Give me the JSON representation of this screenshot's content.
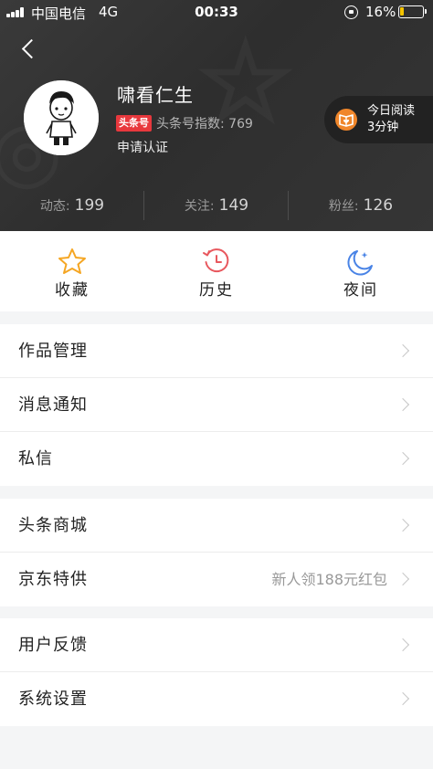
{
  "status_bar": {
    "carrier": "中国电信",
    "network": "4G",
    "time": "00:33",
    "battery": "16%"
  },
  "profile": {
    "username": "啸看仁生",
    "badge": "头条号",
    "index_label": "头条号指数:",
    "index_value": "769",
    "apply_cert": "申请认证"
  },
  "reading": {
    "line1": "今日阅读",
    "line2": "3分钟"
  },
  "stats": [
    {
      "label": "动态:",
      "value": "199"
    },
    {
      "label": "关注:",
      "value": "149"
    },
    {
      "label": "粉丝:",
      "value": "126"
    }
  ],
  "quick": [
    {
      "label": "收藏",
      "icon": "star-icon",
      "color": "#f5a623"
    },
    {
      "label": "历史",
      "icon": "history-clock-icon",
      "color": "#e8585e"
    },
    {
      "label": "夜间",
      "icon": "moon-icon",
      "color": "#4a84e6"
    }
  ],
  "menu": {
    "group1": [
      "作品管理",
      "消息通知",
      "私信"
    ],
    "group2": [
      "头条商城",
      "京东特供"
    ],
    "jd_promo": "新人领188元红包",
    "group3": [
      "用户反馈",
      "系统设置"
    ]
  },
  "colors": {
    "header_bg": "#333333",
    "badge_red": "#e8383d",
    "reading_orange": "#f0862a"
  }
}
